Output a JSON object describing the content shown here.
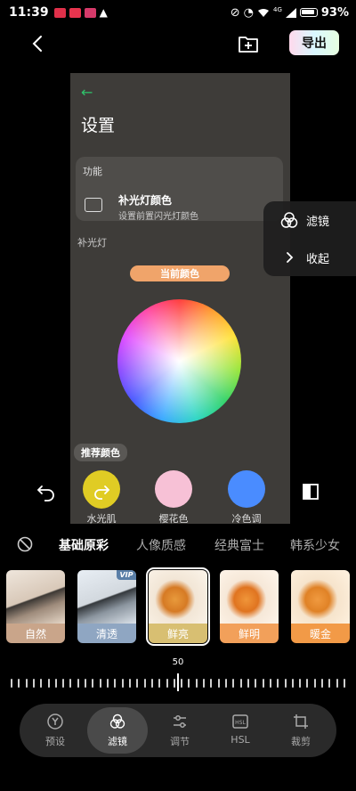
{
  "status_bar": {
    "time": "11:39",
    "network": "4G",
    "battery": "93%"
  },
  "top_bar": {
    "export_label": "导出"
  },
  "preview": {
    "back_arrow": "←",
    "settings_title": "设置",
    "section_label": "功能",
    "item_title": "补光灯颜色",
    "item_subtitle": "设置前置闪光灯颜色",
    "sub_label": "补光灯",
    "current_color_label": "当前颜色",
    "recommend_label": "推荐颜色",
    "swatches": [
      {
        "color": "#e0cc24",
        "label": "水光肌"
      },
      {
        "color": "#f7c1d6",
        "label": "樱花色"
      },
      {
        "color": "#4a8cff",
        "label": "冷色调"
      }
    ]
  },
  "side_panel": {
    "filter_label": "滤镜",
    "collapse_label": "收起"
  },
  "tabs": [
    {
      "label": "基础原彩",
      "active": true
    },
    {
      "label": "人像质感",
      "active": false
    },
    {
      "label": "经典富士",
      "active": false
    },
    {
      "label": "韩系少女",
      "active": false
    }
  ],
  "filters": [
    {
      "label": "自然",
      "vip": false,
      "selected": false,
      "label_bg": "#c9a58a"
    },
    {
      "label": "清透",
      "vip": true,
      "vip_text": "VIP",
      "selected": false,
      "label_bg": "#8fa6c2"
    },
    {
      "label": "鲜亮",
      "vip": false,
      "selected": true,
      "label_bg": "#d8bf72"
    },
    {
      "label": "鲜明",
      "vip": false,
      "selected": false,
      "label_bg": "#f2a05a"
    },
    {
      "label": "暖金",
      "vip": false,
      "selected": false,
      "label_bg": "#f29a47"
    }
  ],
  "slider": {
    "value": "50"
  },
  "bottom_nav": [
    {
      "label": "预设",
      "icon": "preset-icon",
      "active": false
    },
    {
      "label": "滤镜",
      "icon": "filter-icon",
      "active": true
    },
    {
      "label": "调节",
      "icon": "adjust-icon",
      "active": false
    },
    {
      "label": "HSL",
      "icon": "hsl-icon",
      "active": false
    },
    {
      "label": "裁剪",
      "icon": "crop-icon",
      "active": false
    }
  ]
}
